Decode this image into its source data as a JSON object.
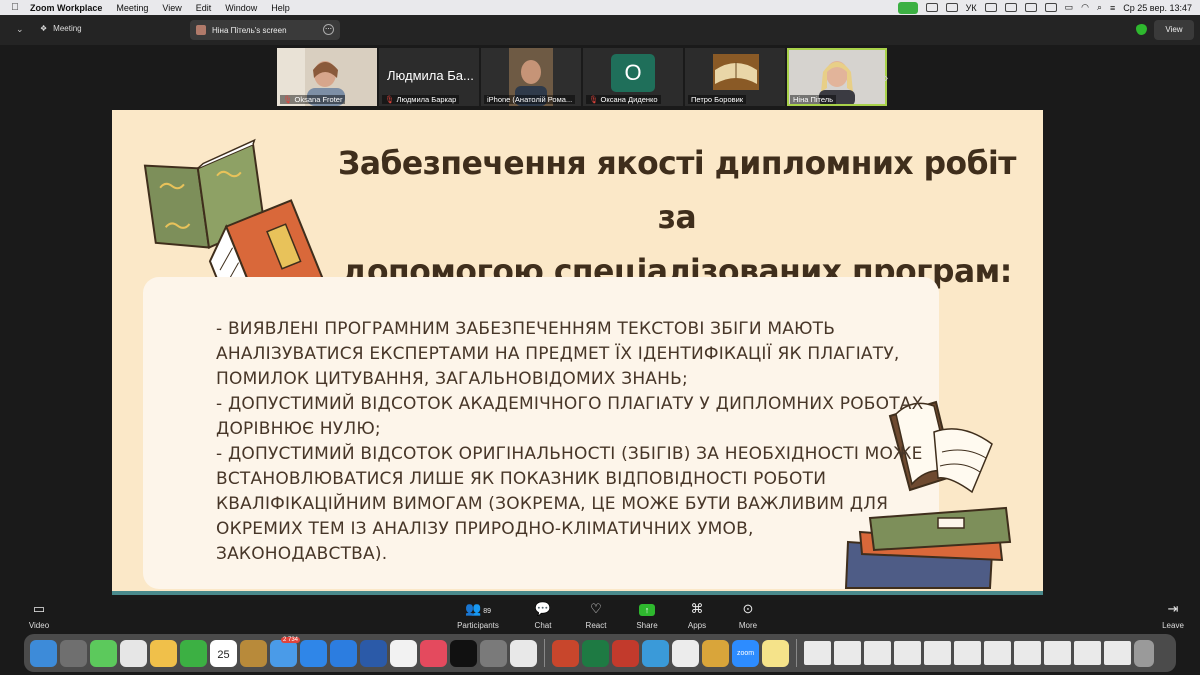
{
  "menubar": {
    "app": "Zoom Workplace",
    "items": [
      "Meeting",
      "View",
      "Edit",
      "Window",
      "Help"
    ],
    "keyboard": "УК",
    "datetime": "Ср 25 вер.  13:47"
  },
  "topbar": {
    "meeting_label": "Meeting",
    "screen_label": "Ніна Пітель's screen",
    "view_label": "View"
  },
  "participants": [
    {
      "name": "Oksana Froter",
      "muted": true
    },
    {
      "name": "Людмила Баркар",
      "big": "Людмила Ба...",
      "muted": true
    },
    {
      "name": "iPhone (Анатолій Рома...",
      "muted": false
    },
    {
      "name": "Оксана Диденко",
      "initial": "O",
      "muted": true
    },
    {
      "name": "Петро Боровик",
      "muted": false
    },
    {
      "name": "Ніна Пітель",
      "muted": false,
      "active": true
    }
  ],
  "slide": {
    "title_lines": [
      "Забезпечення якості дипломних робіт за",
      "допомогою спеціалізованих програм:"
    ],
    "body_lines": [
      "- ВИЯВЛЕНІ ПРОГРАМНИМ ЗАБЕЗПЕЧЕННЯМ ТЕКСТОВІ ЗБІГИ МАЮТЬ",
      "АНАЛІЗУВАТИСЯ ЕКСПЕРТАМИ НА ПРЕДМЕТ ЇХ ІДЕНТИФІКАЦІЇ ЯК ПЛАГІАТУ,",
      "ПОМИЛОК ЦИТУВАННЯ, ЗАГАЛЬНОВІДОМИХ ЗНАНЬ;",
      "- ДОПУСТИМИЙ ВІДСОТОК АКАДЕМІЧНОГО ПЛАГІАТУ У ДИПЛОМНИХ РОБОТАХ",
      "ДОРІВНЮЄ НУЛЮ;",
      "- ДОПУСТИМИЙ ВІДСОТОК ОРИГІНАЛЬНОСТІ (ЗБІГІВ) ЗА НЕОБХІДНОСТІ МОЖЕ",
      "ВСТАНОВЛЮВАТИСЯ ЛИШЕ ЯК ПОКАЗНИК ВІДПОВІДНОСТІ РОБОТИ",
      "КВАЛІФІКАЦІЙНИМ ВИМОГАМ (ЗОКРЕМА, ЦЕ МОЖЕ БУТИ ВАЖЛИВИМ ДЛЯ",
      "ОКРЕМИХ ТЕМ ІЗ АНАЛІЗУ ПРИРОДНО-КЛІМАТИЧНИХ УМОВ,",
      "ЗАКОНОДАВСТВА)."
    ]
  },
  "toolbar": {
    "video": "Video",
    "participants": "Participants",
    "participants_count": "89",
    "chat": "Chat",
    "react": "React",
    "share": "Share",
    "apps": "Apps",
    "more": "More",
    "leave": "Leave"
  },
  "dock": {
    "calendar_day": "25",
    "calendar_month": "SEP",
    "mail_badge": "2 734",
    "zoom_label": "zoom"
  },
  "colors": {
    "slide_bg": "#fbe8c8",
    "card_bg": "#fdf5ea",
    "title": "#3f2e1c",
    "body": "#473628",
    "active_tile": "#a9d24a",
    "share_green": "#2eb82e"
  }
}
